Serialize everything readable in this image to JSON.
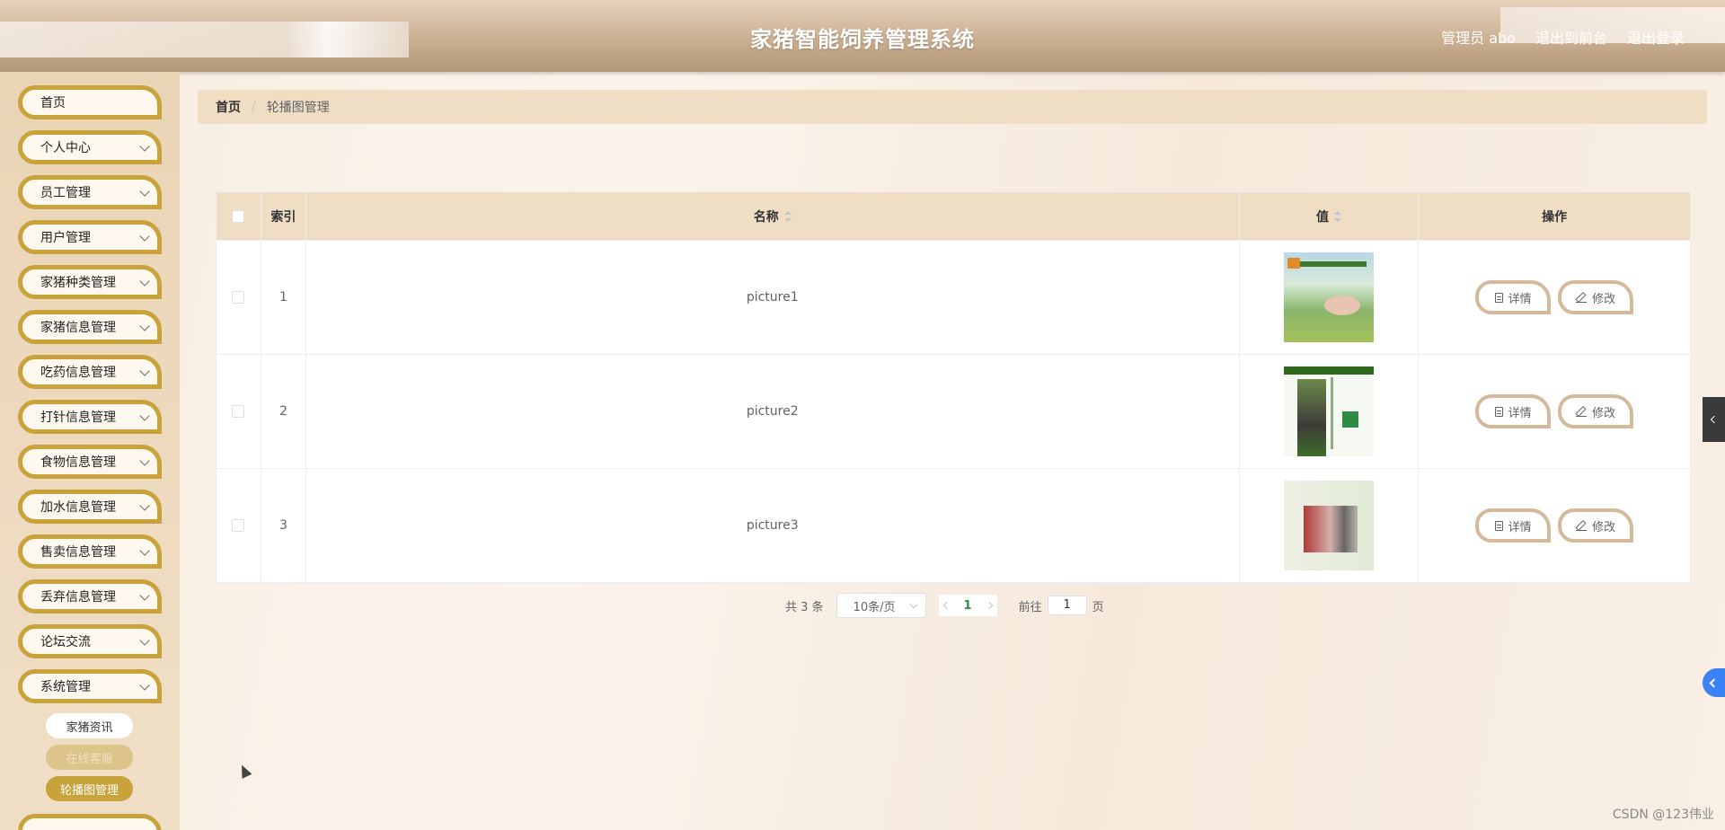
{
  "header": {
    "title": "家猪智能饲养管理系统",
    "user": "管理员 abo",
    "to_front": "退出到前台",
    "logout": "退出登录"
  },
  "sidebar": {
    "items": [
      {
        "label": "首页",
        "expandable": false
      },
      {
        "label": "个人中心",
        "expandable": true
      },
      {
        "label": "员工管理",
        "expandable": true
      },
      {
        "label": "用户管理",
        "expandable": true
      },
      {
        "label": "家猪种类管理",
        "expandable": true
      },
      {
        "label": "家猪信息管理",
        "expandable": true
      },
      {
        "label": "吃药信息管理",
        "expandable": true
      },
      {
        "label": "打针信息管理",
        "expandable": true
      },
      {
        "label": "食物信息管理",
        "expandable": true
      },
      {
        "label": "加水信息管理",
        "expandable": true
      },
      {
        "label": "售卖信息管理",
        "expandable": true
      },
      {
        "label": "丢弃信息管理",
        "expandable": true
      },
      {
        "label": "论坛交流",
        "expandable": true
      },
      {
        "label": "系统管理",
        "expandable": true
      }
    ],
    "subitems": [
      "家猪资讯",
      "在线客服",
      "轮播图管理"
    ]
  },
  "breadcrumb": {
    "home": "首页",
    "separator": "/",
    "current": "轮播图管理"
  },
  "table": {
    "headers": {
      "index": "索引",
      "name": "名称",
      "value": "值",
      "ops": "操作"
    },
    "rows": [
      {
        "index": "1",
        "name": "picture1"
      },
      {
        "index": "2",
        "name": "picture2"
      },
      {
        "index": "3",
        "name": "picture3"
      }
    ],
    "detail_label": "详情",
    "edit_label": "修改"
  },
  "pager": {
    "total": "共 3 条",
    "size": "10条/页",
    "current": "1",
    "goto_prefix": "前往",
    "goto_value": "1",
    "goto_suffix": "页"
  },
  "watermark": "CSDN @123伟业",
  "colors": {
    "accent": "#c8a23a",
    "header_bg": "#c8ac8e",
    "table_head": "#f0dec4"
  }
}
